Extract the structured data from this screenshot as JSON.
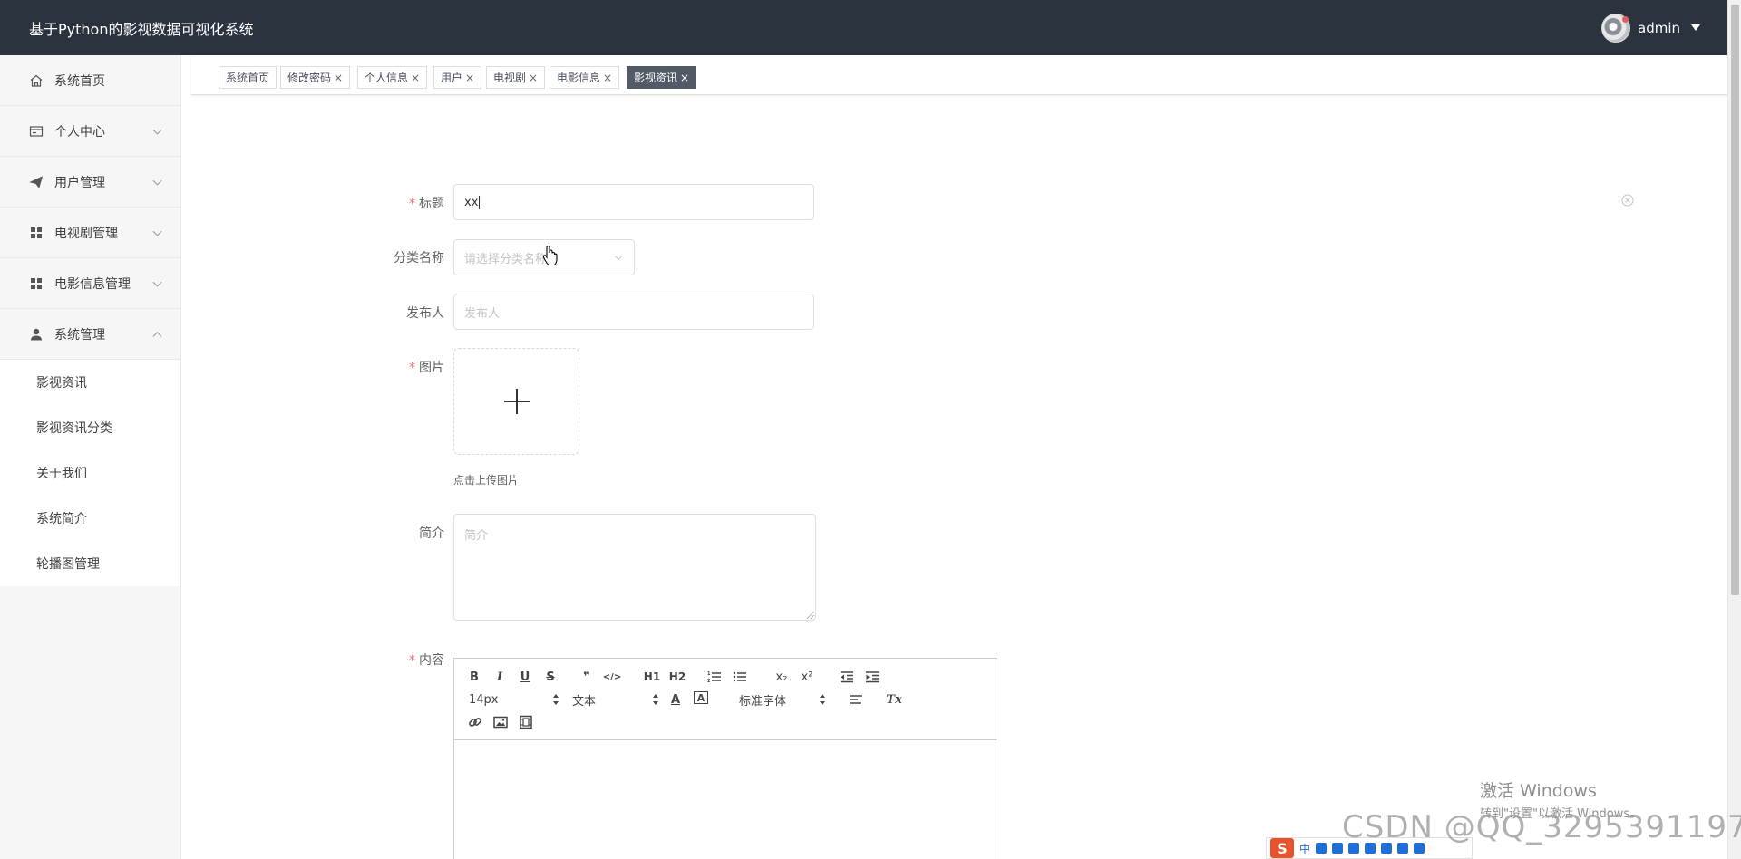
{
  "header": {
    "title": "基于Python的影视数据可视化系统",
    "username": "admin"
  },
  "sidebar": {
    "items": [
      {
        "label": "系统首页",
        "icon": "home-icon"
      },
      {
        "label": "个人中心",
        "icon": "id-card-icon"
      },
      {
        "label": "用户管理",
        "icon": "paper-plane-icon"
      },
      {
        "label": "电视剧管理",
        "icon": "grid-icon"
      },
      {
        "label": "电影信息管理",
        "icon": "grid-icon"
      },
      {
        "label": "系统管理",
        "icon": "user-icon"
      }
    ],
    "submenu": [
      "影视资讯",
      "影视资讯分类",
      "关于我们",
      "系统简介",
      "轮播图管理"
    ]
  },
  "tags": [
    {
      "label": "系统首页",
      "closable": false,
      "active": false
    },
    {
      "label": "修改密码",
      "closable": true,
      "active": false
    },
    {
      "label": "个人信息",
      "closable": true,
      "active": false
    },
    {
      "label": "用户",
      "closable": true,
      "active": false
    },
    {
      "label": "电视剧",
      "closable": true,
      "active": false
    },
    {
      "label": "电影信息",
      "closable": true,
      "active": false
    },
    {
      "label": "影视资讯",
      "closable": true,
      "active": true
    }
  ],
  "form": {
    "title_label": "标题",
    "title_value": "xx",
    "category_label": "分类名称",
    "category_placeholder": "请选择分类名称",
    "publisher_label": "发布人",
    "publisher_placeholder": "发布人",
    "image_label": "图片",
    "upload_hint": "点击上传图片",
    "intro_label": "简介",
    "intro_placeholder": "简介",
    "content_label": "内容",
    "required_mark": "*"
  },
  "editor": {
    "font_size": "14px",
    "paragraph": "文本",
    "font_family": "标准字体",
    "buttons": {
      "bold": "B",
      "italic": "I",
      "underline": "U",
      "strike": "S",
      "quote": "❞",
      "code": "</>",
      "h1": "H1",
      "h2": "H2",
      "sub": "x₂",
      "sup": "x²",
      "color": "A",
      "bg": "A",
      "clean": "Tx"
    }
  },
  "watermark": {
    "windows_line1": "激活 Windows",
    "windows_line2": "转到\"设置\"以激活 Windows。",
    "csdn": "CSDN @QQ_3295391197"
  },
  "ime": {
    "logo": "S",
    "mode": "中"
  },
  "close_glyph": "×"
}
